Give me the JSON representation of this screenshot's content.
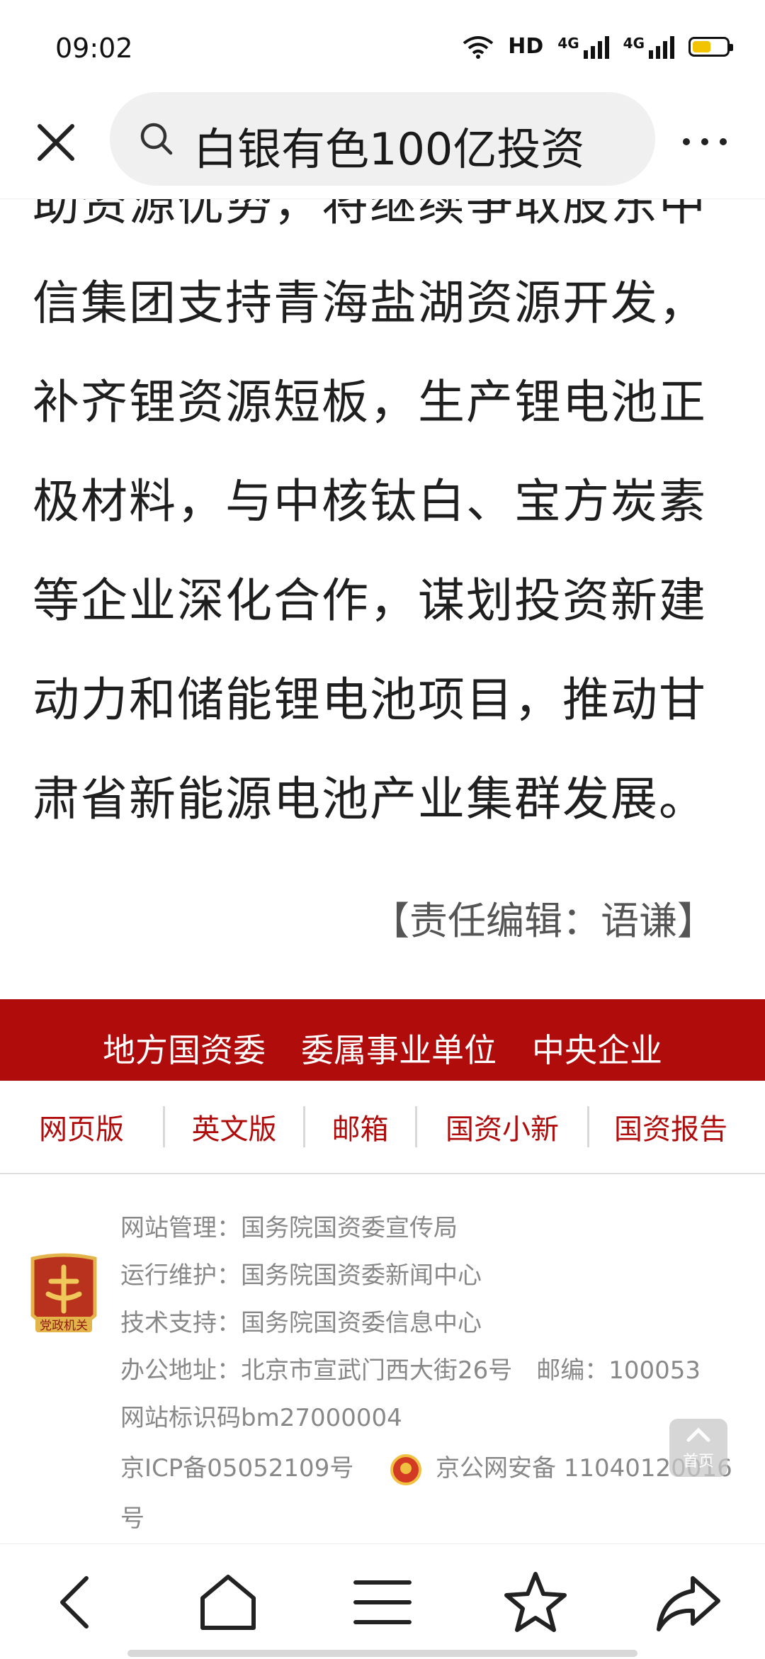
{
  "status": {
    "time": "09:02",
    "hd": "HD",
    "net1": "4G",
    "net2": "4G",
    "battery_level": 0.55,
    "battery_color": "#f2c400"
  },
  "browser": {
    "search_text": "白银有色100亿投资"
  },
  "article": {
    "lines": [
      "助资源优势，将继续争取股东中",
      "信集团支持青海盐湖资源开发，",
      "补齐锂资源短板，生产锂电池正",
      "极材料，与中核钛白、宝方炭素",
      "等企业深化合作，谋划投资新建",
      "动力和储能锂电池项目，推动甘",
      "肃省新能源电池产业集群发展。"
    ],
    "editor": "【责任编辑：语谦】"
  },
  "red_band": {
    "color": "#b00c0c",
    "links": [
      "地方国资委",
      "委属事业单位",
      "中央企业"
    ]
  },
  "footer_links": [
    "网页版",
    "英文版",
    "邮箱",
    "国资小新",
    "国资报告"
  ],
  "info": {
    "management": "网站管理：国务院国资委宣传局",
    "maintenance": "运行维护：国务院国资委新闻中心",
    "tech": "技术支持：国务院国资委信息中心",
    "address": "办公地址：北京市宣武门西大街26号　邮编：100053",
    "site_id": "网站标识码bm27000004",
    "icp": "京ICP备05052109号",
    "police": "京公网安备 11040120016",
    "police_suffix": "号",
    "badge_text": "党政机关"
  },
  "float_top_label": "首页"
}
